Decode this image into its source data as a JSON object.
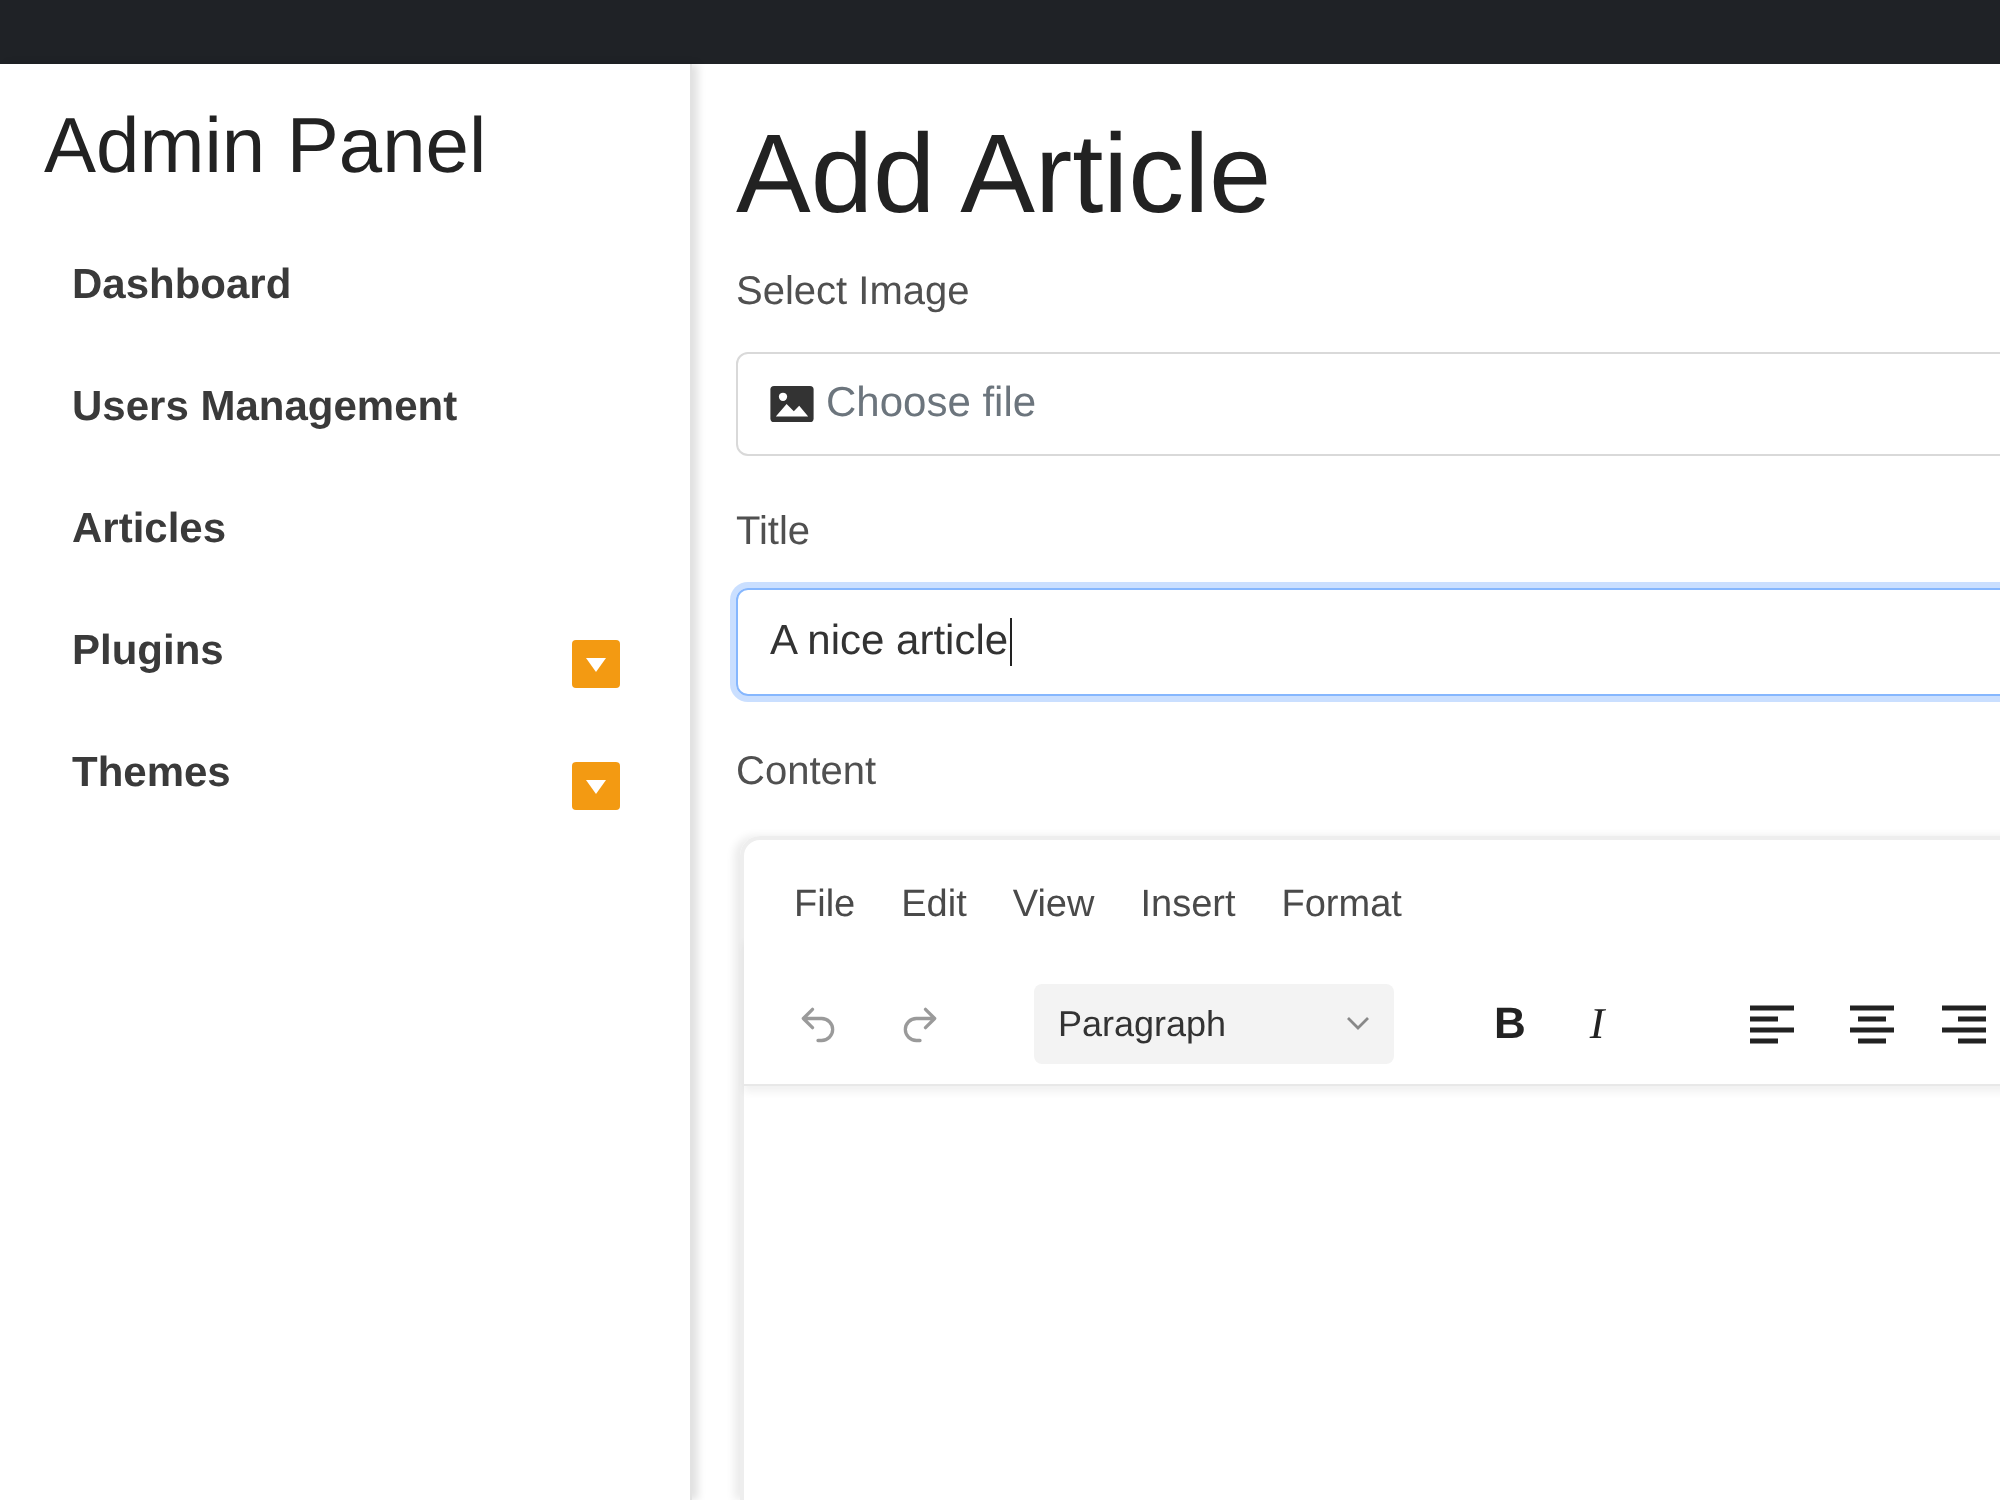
{
  "sidebar": {
    "title": "Admin Panel",
    "items": [
      {
        "label": "Dashboard",
        "kind": "link"
      },
      {
        "label": "Users Management",
        "kind": "link"
      },
      {
        "label": "Articles",
        "kind": "link"
      },
      {
        "label": "Plugins",
        "kind": "dropdown"
      },
      {
        "label": "Themes",
        "kind": "dropdown"
      }
    ]
  },
  "main": {
    "heading": "Add Article",
    "image_field": {
      "label": "Select Image",
      "placeholder": "Choose file",
      "focused": false
    },
    "title_field": {
      "label": "Title",
      "value": "A nice article",
      "focused": true
    },
    "content_editor": {
      "label": "Content",
      "menu": [
        "File",
        "Edit",
        "View",
        "Insert",
        "Format"
      ],
      "toolbar": [
        {
          "kind": "undo",
          "disabled": true
        },
        {
          "kind": "redo",
          "disabled": true
        },
        {
          "kind": "select",
          "value": "Paragraph",
          "disabled": false
        },
        {
          "kind": "bold",
          "label": "B",
          "disabled": false
        },
        {
          "kind": "italic",
          "label": "I",
          "disabled": false
        },
        {
          "kind": "align-left",
          "disabled": false
        },
        {
          "kind": "align-center",
          "disabled": false
        },
        {
          "kind": "align-right",
          "disabled": false
        }
      ]
    }
  }
}
